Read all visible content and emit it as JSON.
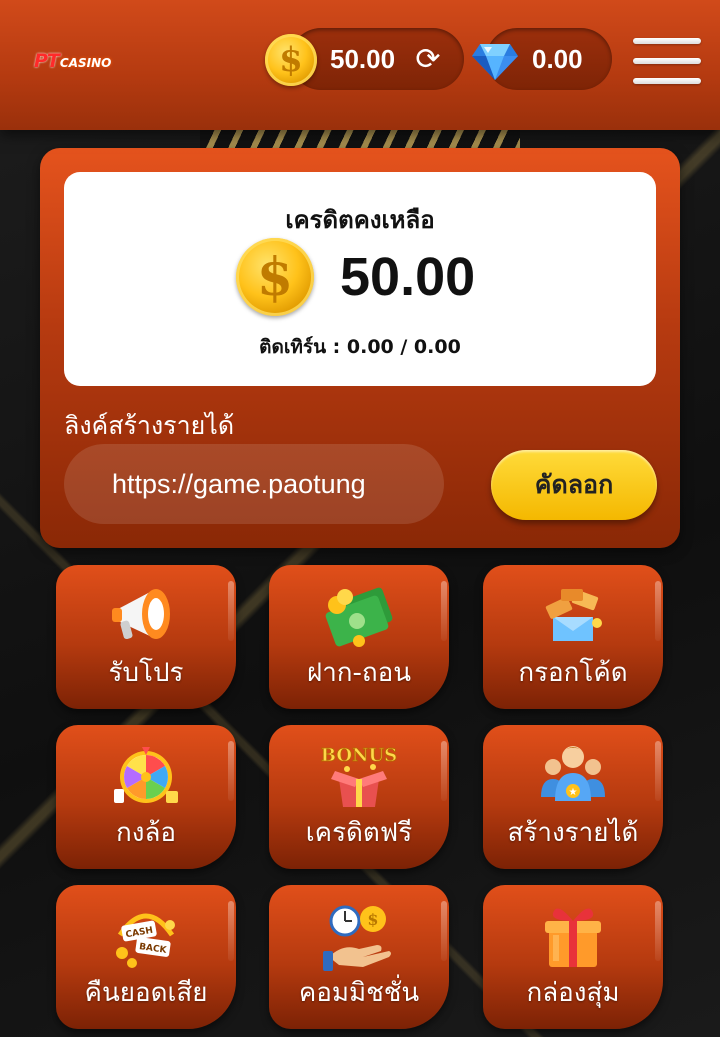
{
  "header": {
    "logo_main": "PT",
    "logo_sub": "CASINO",
    "coin_balance": "50.00",
    "gem_balance": "0.00",
    "coin_symbol": "$",
    "refresh_glyph": "⟳"
  },
  "balance_card": {
    "label": "เครดิตคงเหลือ",
    "value": "50.00",
    "coin_symbol": "$",
    "turnover": "ติดเทิร์น : 0.00 / 0.00"
  },
  "referral": {
    "label": "ลิงค์สร้างรายได้",
    "link_value": "https://game.paotung",
    "copy_label": "คัดลอก"
  },
  "menu": {
    "items": [
      {
        "label": "รับโปร",
        "icon": "megaphone-icon"
      },
      {
        "label": "ฝาก-ถอน",
        "icon": "cash-money-icon"
      },
      {
        "label": "กรอกโค้ด",
        "icon": "coupon-envelope-icon"
      },
      {
        "label": "กงล้อ",
        "icon": "lucky-wheel-icon"
      },
      {
        "label": "เครดิตฟรี",
        "icon": "bonus-box-icon"
      },
      {
        "label": "สร้างรายได้",
        "icon": "team-people-icon"
      },
      {
        "label": "คืนยอดเสีย",
        "icon": "cashback-icon"
      },
      {
        "label": "คอมมิชชั่น",
        "icon": "commission-hand-icon"
      },
      {
        "label": "กล่องสุ่ม",
        "icon": "gift-box-icon"
      }
    ]
  },
  "colors": {
    "primary": "#d14a1a",
    "accent_yellow": "#ffd21f",
    "coin_gold": "#ffc21a",
    "background": "#151515"
  }
}
